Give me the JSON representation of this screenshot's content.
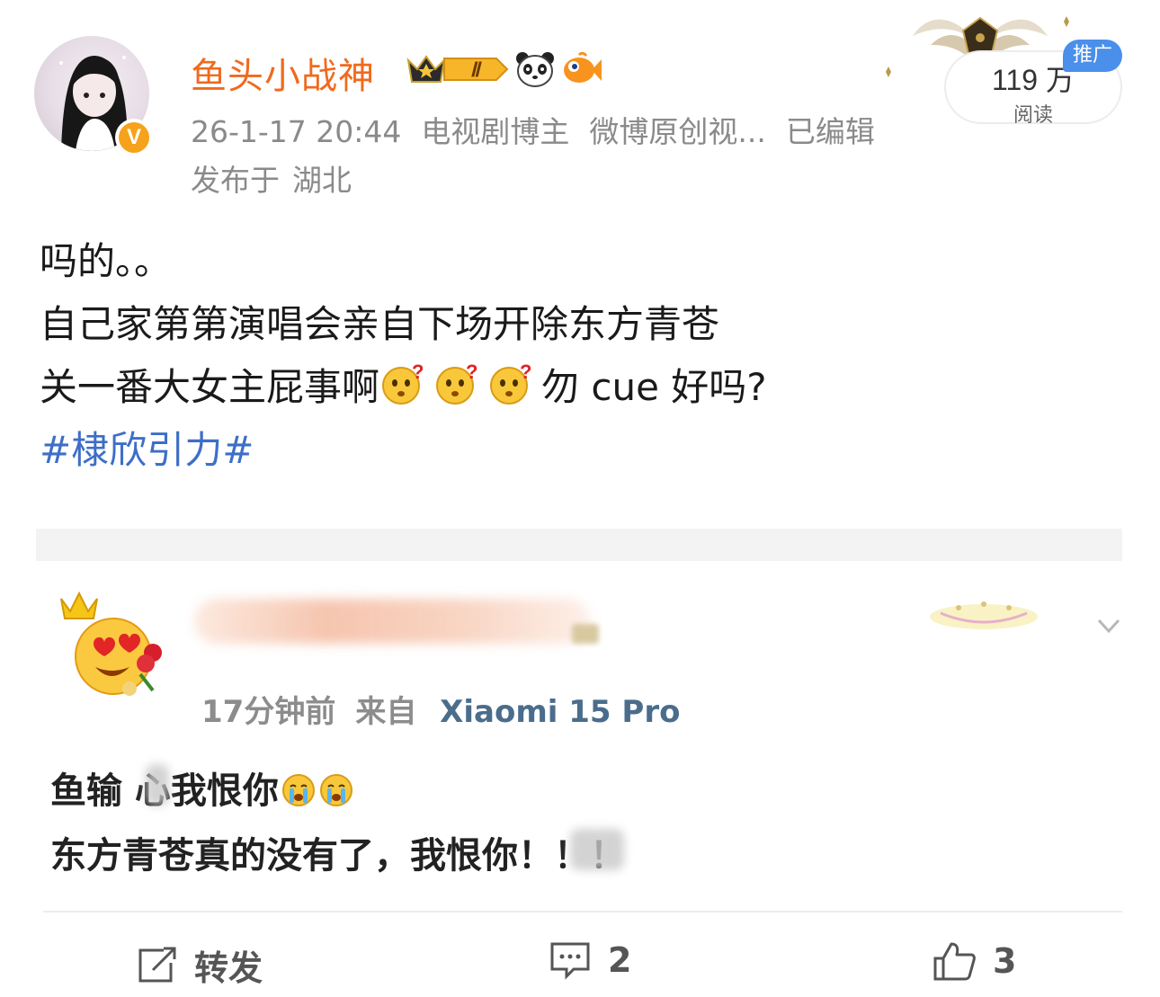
{
  "post": {
    "username": "鱼头小战神",
    "level_badge": "Ⅱ",
    "verified_mark": "V",
    "meta": {
      "time": "26-1-17 20:44",
      "role": "电视剧博主",
      "source": "微博原创视...",
      "edited": "已编辑"
    },
    "location": {
      "prefix": "发布于",
      "place": "湖北"
    },
    "reads": {
      "count": "119 万",
      "label": "阅读",
      "promo_badge": "推广"
    },
    "body": {
      "line1": "吗的。。",
      "line2": "自己家第第演唱会亲自下场开除东方青苍",
      "line3_start": "关一番大女主屁事啊",
      "line3_end": "勿 cue 好吗?",
      "hashtag": "#棣欣引力#"
    }
  },
  "embedded_comment": {
    "time": "17分钟前",
    "from_label": "来自",
    "device": "Xiaomi 15 Pro",
    "line1": "鱼输 心我恨你",
    "line2": "东方青苍真的没有了，我恨你！！！"
  },
  "actions": {
    "repost_label": "转发",
    "comment_count": "2",
    "like_count": "3"
  },
  "colors": {
    "username": "#f06a1d",
    "hashtag": "#3e6ec7",
    "promo": "#4a8fea",
    "verified": "#f7a21b",
    "device": "#4a6d8c"
  }
}
